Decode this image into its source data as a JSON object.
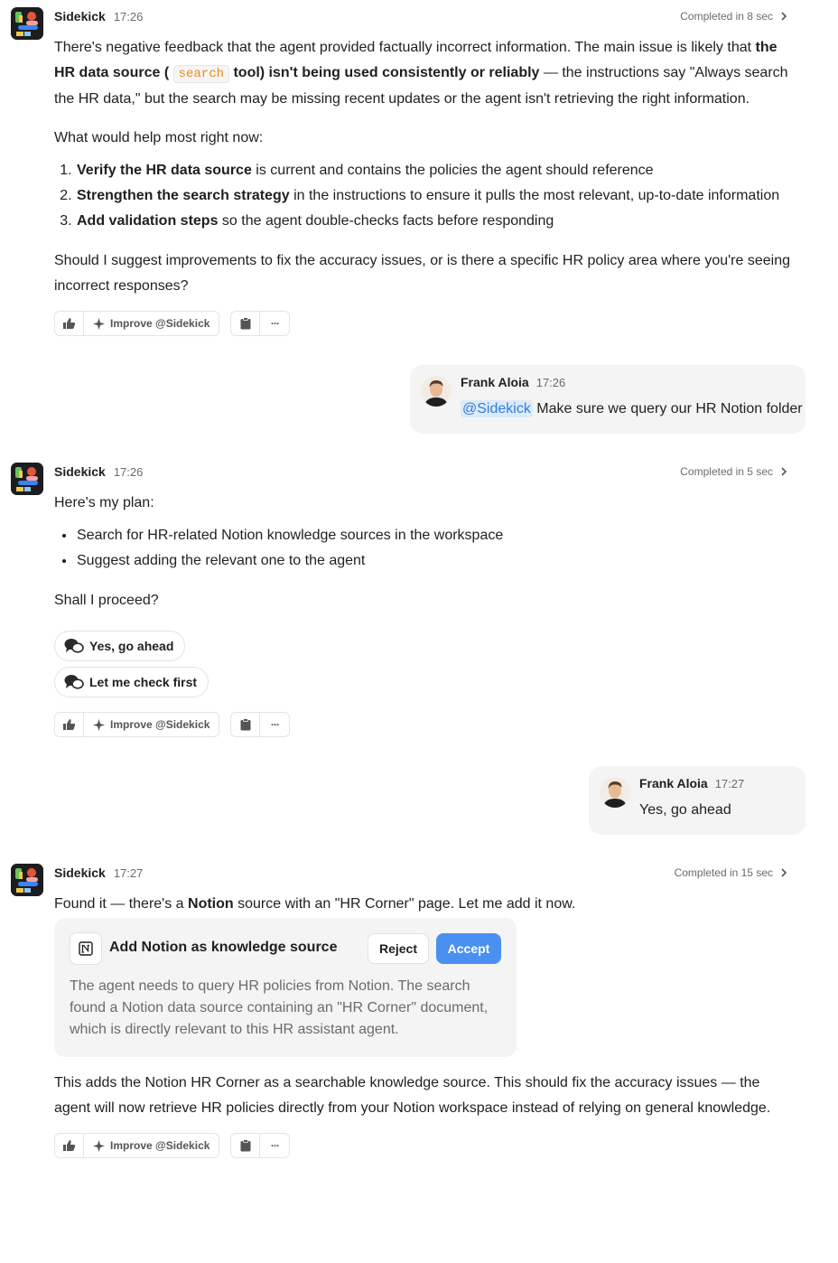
{
  "bot_name": "Sidekick",
  "user_name": "Frank Aloia",
  "messages": {
    "m1": {
      "time": "17:26",
      "completed": "Completed in 8 sec",
      "intro_a": "There's negative feedback that the agent provided factually incorrect information. The main issue is likely that ",
      "intro_bold_a": "the HR data source (",
      "intro_code": "search",
      "intro_bold_b": " tool) isn't being used consistently or reliably",
      "intro_b": " — the instructions say \"Always search the HR data,\" but the search may be missing recent updates or the agent isn't retrieving the right information.",
      "help_text": "What would help most right now:",
      "steps": [
        {
          "bold": "Verify the HR data source",
          "rest": " is current and contains the policies the agent should reference"
        },
        {
          "bold": "Strengthen the search strategy",
          "rest": " in the instructions to ensure it pulls the most relevant, up-to-date information"
        },
        {
          "bold": "Add validation steps",
          "rest": " so the agent double-checks facts before responding"
        }
      ],
      "question": "Should I suggest improvements to fix the accuracy issues, or is there a specific HR policy area where you're seeing incorrect responses?"
    },
    "u1": {
      "time": "17:26",
      "mention": "@Sidekick",
      "text": " Make sure we query our HR Notion folder"
    },
    "m2": {
      "time": "17:26",
      "completed": "Completed in 5 sec",
      "plan_intro": "Here's my plan:",
      "plan": [
        "Search for HR-related Notion knowledge sources in the workspace",
        "Suggest adding the relevant one to the agent"
      ],
      "ask": "Shall I proceed?",
      "quick_yes": "Yes, go ahead",
      "quick_check": "Let me check first"
    },
    "u2": {
      "time": "17:27",
      "text": "Yes, go ahead"
    },
    "m3": {
      "time": "17:27",
      "completed": "Completed in 15 sec",
      "found_a": "Found it — there's a ",
      "found_bold": "Notion",
      "found_b": " source with an \"HR Corner\" page. Let me add it now.",
      "card_title": "Add Notion as knowledge source",
      "reject_label": "Reject",
      "accept_label": "Accept",
      "card_desc": "The agent needs to query HR policies from Notion. The search found a Notion data source containing an \"HR Corner\" document, which is directly relevant to this HR assistant agent.",
      "result": "This adds the Notion HR Corner as a searchable knowledge source. This should fix the accuracy issues — the agent will now retrieve HR policies directly from your Notion workspace instead of relying on general knowledge."
    }
  },
  "actions": {
    "improve_label": "Improve @Sidekick",
    "more_label": "···"
  },
  "icons": {
    "thumbs_up": "thumbs-up-icon",
    "improve": "sparkle-icon",
    "copy": "clipboard-icon",
    "more": "more-icon",
    "chat": "chat-bubbles-icon",
    "notion": "notion-icon",
    "chevron": "chevron-right-icon"
  },
  "colors": {
    "accept": "#4a90f0",
    "code": "#e8891b",
    "mention": "#2f7fd8",
    "mention_bg": "#dceafa",
    "bubble": "#f4f4f5"
  }
}
